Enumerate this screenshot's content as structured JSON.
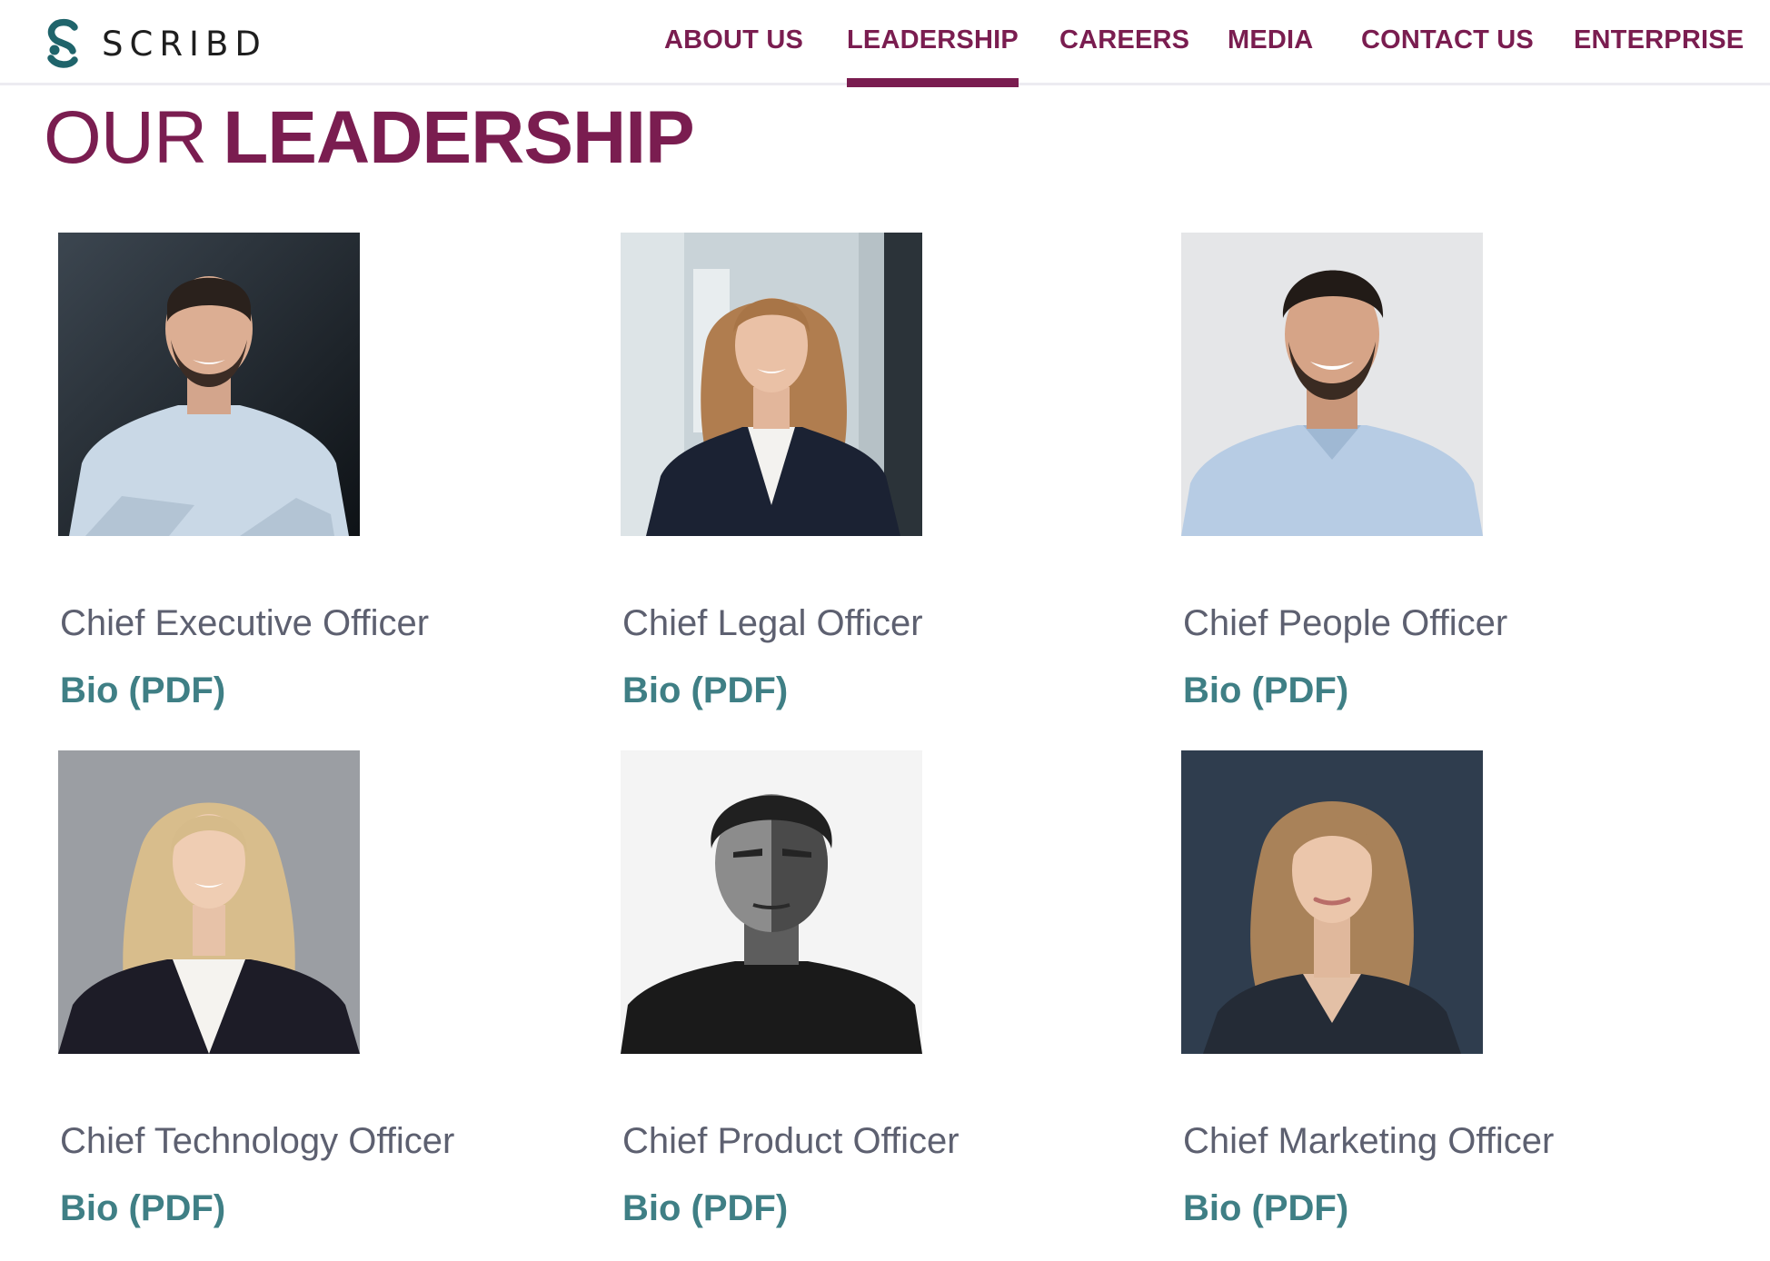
{
  "brand": {
    "name": "SCRIBD",
    "logo_icon": "scribd-s-logo-icon",
    "primary_color": "#7a1d50",
    "accent_color": "#3f7f85"
  },
  "nav": {
    "items": [
      {
        "label": "ABOUT US",
        "active": false
      },
      {
        "label": "LEADERSHIP",
        "active": true
      },
      {
        "label": "CAREERS",
        "active": false
      },
      {
        "label": "MEDIA",
        "active": false
      },
      {
        "label": "CONTACT US",
        "active": false
      },
      {
        "label": "ENTERPRISE",
        "active": false
      }
    ]
  },
  "page": {
    "title_light": "OUR",
    "title_bold": "LEADERSHIP"
  },
  "leaders": [
    {
      "role": "Chief Executive Officer",
      "bio_link": "Bio (PDF)",
      "photo": "portrait-photo"
    },
    {
      "role": "Chief Legal Officer",
      "bio_link": "Bio (PDF)",
      "photo": "portrait-photo"
    },
    {
      "role": "Chief People Officer",
      "bio_link": "Bio (PDF)",
      "photo": "portrait-photo"
    },
    {
      "role": "Chief Technology Officer",
      "bio_link": "Bio (PDF)",
      "photo": "portrait-photo"
    },
    {
      "role": "Chief Product Officer",
      "bio_link": "Bio (PDF)",
      "photo": "portrait-photo"
    },
    {
      "role": "Chief Marketing Officer",
      "bio_link": "Bio (PDF)",
      "photo": "portrait-photo"
    }
  ]
}
